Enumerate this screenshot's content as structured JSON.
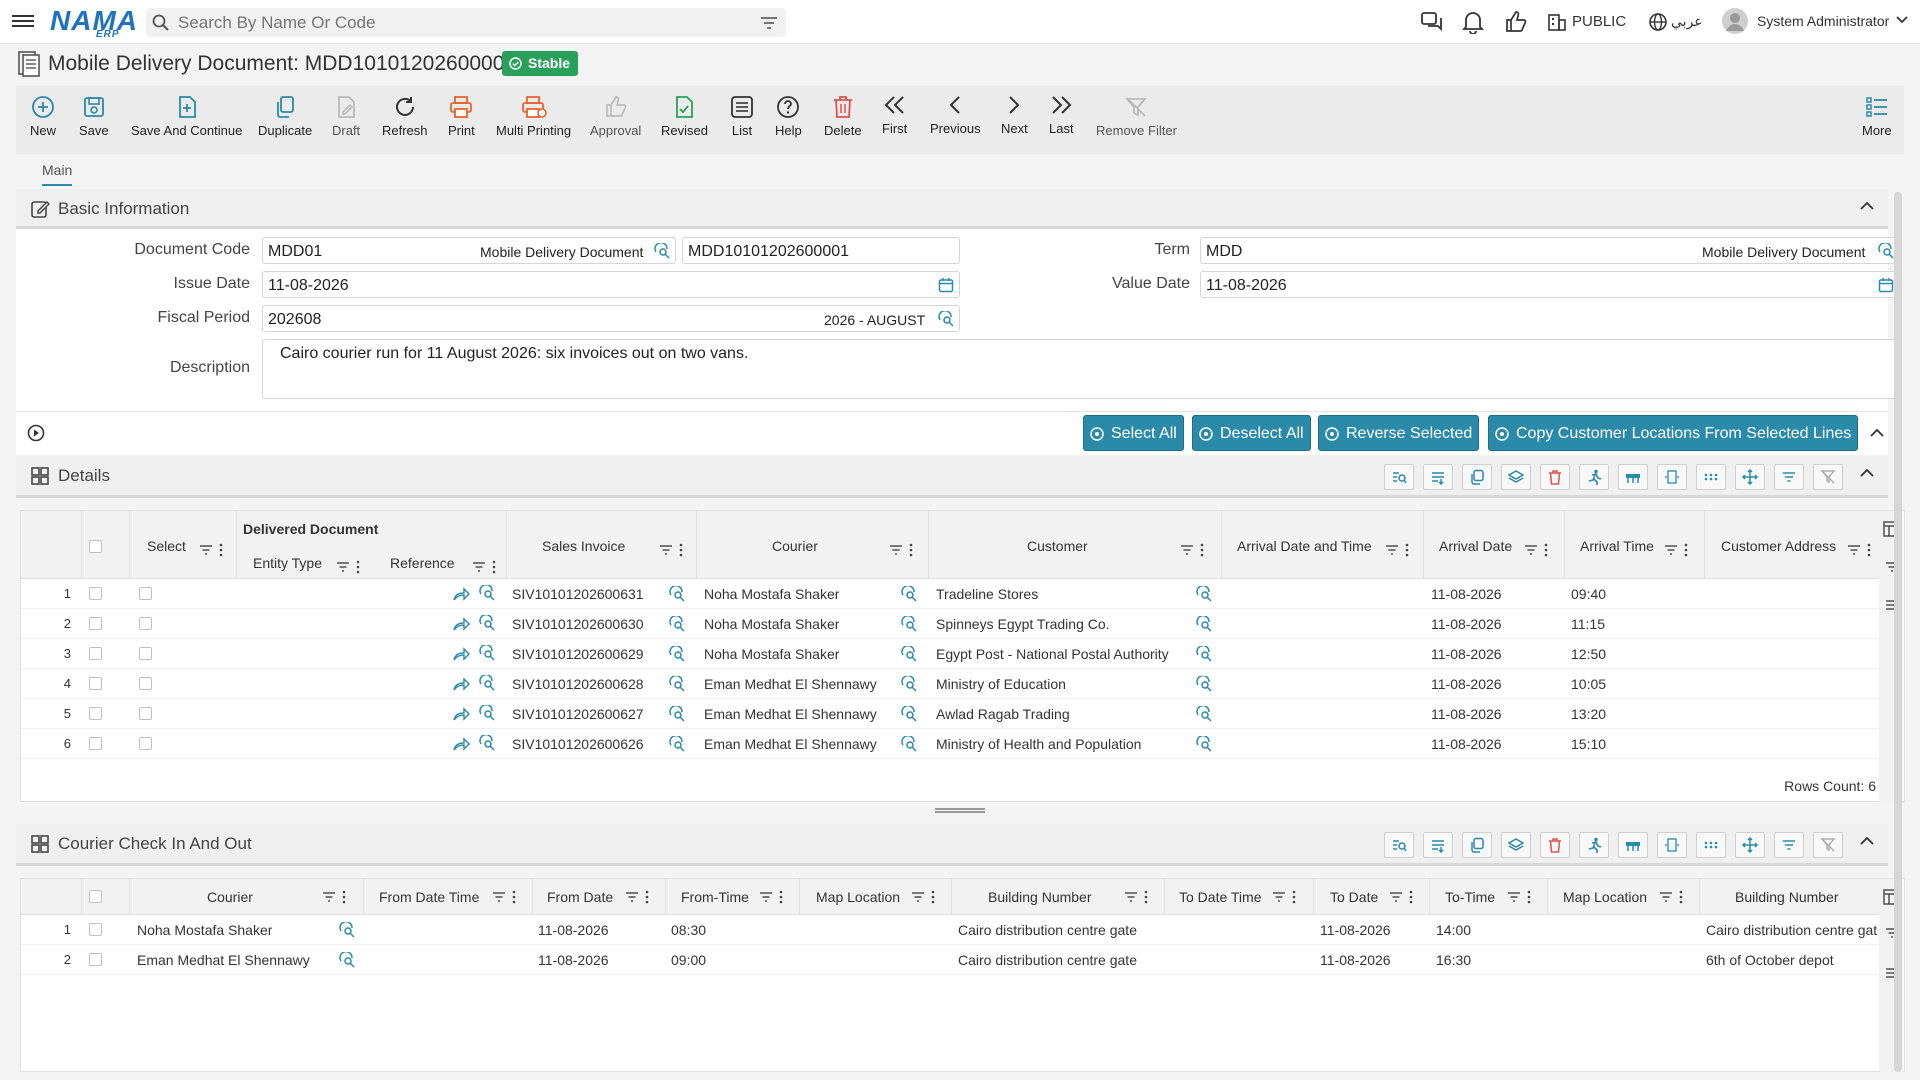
{
  "header": {
    "logo": "NAMA",
    "logo_sub": "ERP",
    "search_placeholder": "Search By Name Or Code",
    "visibility": "PUBLIC",
    "language": "عربي",
    "user": "System Administrator"
  },
  "doc": {
    "title": "Mobile Delivery Document: MDD10101202600001",
    "status": "Stable"
  },
  "toolbar": [
    {
      "label": "New",
      "icon": "plus-circle-icon"
    },
    {
      "label": "Save",
      "icon": "save-icon"
    },
    {
      "label": "Save And Continue",
      "icon": "save-continue-icon"
    },
    {
      "label": "Duplicate",
      "icon": "duplicate-icon"
    },
    {
      "label": "Draft",
      "icon": "draft-icon"
    },
    {
      "label": "Refresh",
      "icon": "refresh-icon"
    },
    {
      "label": "Print",
      "icon": "print-icon"
    },
    {
      "label": "Multi Printing",
      "icon": "multi-print-icon"
    },
    {
      "label": "Approval",
      "icon": "approval-icon"
    },
    {
      "label": "Revised",
      "icon": "revised-icon"
    },
    {
      "label": "List",
      "icon": "list-icon"
    },
    {
      "label": "Help",
      "icon": "help-icon"
    },
    {
      "label": "Delete",
      "icon": "delete-icon"
    },
    {
      "label": "First",
      "icon": "first-icon"
    },
    {
      "label": "Previous",
      "icon": "previous-icon"
    },
    {
      "label": "Next",
      "icon": "next-icon"
    },
    {
      "label": "Last",
      "icon": "last-icon"
    },
    {
      "label": "Remove Filter",
      "icon": "remove-filter-icon"
    },
    {
      "label": "More",
      "icon": "more-icon"
    }
  ],
  "tabs": {
    "main": "Main"
  },
  "basic": {
    "title": "Basic Information",
    "document_code_label": "Document Code",
    "document_code": "MDD01",
    "document_code_name": "Mobile Delivery Document",
    "document_number": "MDD10101202600001",
    "term_label": "Term",
    "term": "MDD",
    "term_name": "Mobile Delivery Document",
    "issue_date_label": "Issue Date",
    "issue_date": "11-08-2026",
    "value_date_label": "Value Date",
    "value_date": "11-08-2026",
    "fiscal_period_label": "Fiscal Period",
    "fiscal_period": "202608",
    "fiscal_period_name": "2026 - AUGUST",
    "description_label": "Description",
    "description": "Cairo courier run for 11 August 2026: six invoices out on two vans."
  },
  "actions": {
    "select_all": "Select All",
    "deselect_all": "Deselect All",
    "reverse_selected": "Reverse Selected",
    "copy_locations": "Copy Customer Locations From Selected Lines"
  },
  "details": {
    "title": "Details",
    "group_header": "Delivered Document",
    "columns": {
      "select": "Select",
      "entity_type": "Entity Type",
      "reference": "Reference",
      "sales_invoice": "Sales Invoice",
      "courier": "Courier",
      "customer": "Customer",
      "arrival_dt": "Arrival Date and Time",
      "arrival_date": "Arrival Date",
      "arrival_time": "Arrival Time",
      "customer_address": "Customer Address"
    },
    "rows": [
      {
        "n": "1",
        "invoice": "SIV10101202600631",
        "courier": "Noha Mostafa Shaker",
        "customer": "Tradeline Stores",
        "date": "11-08-2026",
        "time": "09:40"
      },
      {
        "n": "2",
        "invoice": "SIV10101202600630",
        "courier": "Noha Mostafa Shaker",
        "customer": "Spinneys Egypt Trading Co.",
        "date": "11-08-2026",
        "time": "11:15"
      },
      {
        "n": "3",
        "invoice": "SIV10101202600629",
        "courier": "Noha Mostafa Shaker",
        "customer": "Egypt Post - National Postal Authority",
        "date": "11-08-2026",
        "time": "12:50"
      },
      {
        "n": "4",
        "invoice": "SIV10101202600628",
        "courier": "Eman Medhat El Shennawy",
        "customer": "Ministry of Education",
        "date": "11-08-2026",
        "time": "10:05"
      },
      {
        "n": "5",
        "invoice": "SIV10101202600627",
        "courier": "Eman Medhat El Shennawy",
        "customer": "Awlad Ragab Trading",
        "date": "11-08-2026",
        "time": "13:20"
      },
      {
        "n": "6",
        "invoice": "SIV10101202600626",
        "courier": "Eman Medhat El Shennawy",
        "customer": "Ministry of Health and Population",
        "date": "11-08-2026",
        "time": "15:10"
      }
    ],
    "rows_count": "Rows Count: 6"
  },
  "checkin": {
    "title": "Courier Check In And Out",
    "columns": {
      "courier": "Courier",
      "from_dt": "From Date Time",
      "from_date": "From Date",
      "from_time": "From-Time",
      "map1": "Map Location",
      "building1": "Building Number",
      "to_dt": "To Date Time",
      "to_date": "To Date",
      "to_time": "To-Time",
      "map2": "Map Location",
      "building2": "Building Number"
    },
    "rows": [
      {
        "n": "1",
        "courier": "Noha Mostafa Shaker",
        "from_date": "11-08-2026",
        "from_time": "08:30",
        "building1": "Cairo distribution centre gate",
        "to_date": "11-08-2026",
        "to_time": "14:00",
        "building2": "Cairo distribution centre gat"
      },
      {
        "n": "2",
        "courier": "Eman Medhat El Shennawy",
        "from_date": "11-08-2026",
        "from_time": "09:00",
        "building1": "Cairo distribution centre gate",
        "to_date": "11-08-2026",
        "to_time": "16:30",
        "building2": "6th of October depot"
      }
    ]
  },
  "colors": {
    "accent": "#2a8aa8",
    "brand": "#1e73be",
    "status": "#2aa05a",
    "danger": "#d9534f",
    "print": "#e8632b"
  }
}
